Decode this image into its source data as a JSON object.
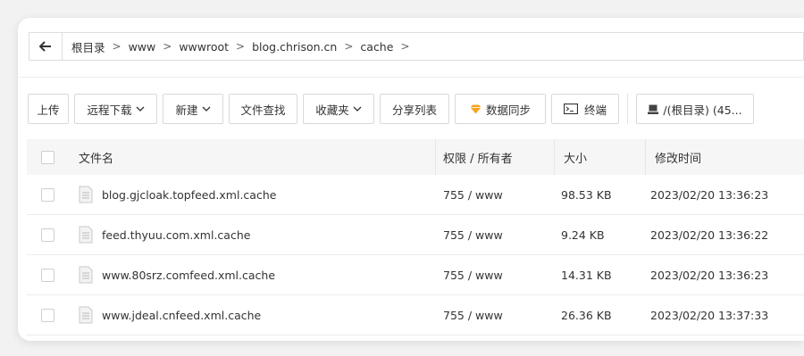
{
  "path_bar": {
    "crumbs": [
      "根目录",
      "www",
      "wwwroot",
      "blog.chrison.cn",
      "cache"
    ],
    "separator": ">"
  },
  "toolbar": {
    "upload": "上传",
    "remote_download": "远程下载",
    "new": "新建",
    "file_search": "文件查找",
    "favorites": "收藏夹",
    "share_list": "分享列表",
    "data_sync": "数据同步",
    "terminal": "终端",
    "disk": "/(根目录) (45..."
  },
  "table": {
    "headers": {
      "name": "文件名",
      "perm": "权限 / 所有者",
      "size": "大小",
      "time": "修改时间"
    },
    "rows": [
      {
        "name": "blog.gjcloak.topfeed.xml.cache",
        "perm": "755 / www",
        "size": "98.53 KB",
        "time": "2023/02/20 13:36:23"
      },
      {
        "name": "feed.thyuu.com.xml.cache",
        "perm": "755 / www",
        "size": "9.24 KB",
        "time": "2023/02/20 13:36:22"
      },
      {
        "name": "www.80srz.comfeed.xml.cache",
        "perm": "755 / www",
        "size": "14.31 KB",
        "time": "2023/02/20 13:36:23"
      },
      {
        "name": "www.jdeal.cnfeed.xml.cache",
        "perm": "755 / www",
        "size": "26.36 KB",
        "time": "2023/02/20 13:37:33"
      }
    ]
  },
  "colors": {
    "data_sync_icon": "#f5a623",
    "border": "#d9d9d9",
    "header_bg": "#f6f6f6"
  },
  "icons": [
    "back-arrow-icon",
    "chevron-down-icon",
    "diamond-icon",
    "terminal-icon",
    "disk-icon",
    "file-icon"
  ]
}
